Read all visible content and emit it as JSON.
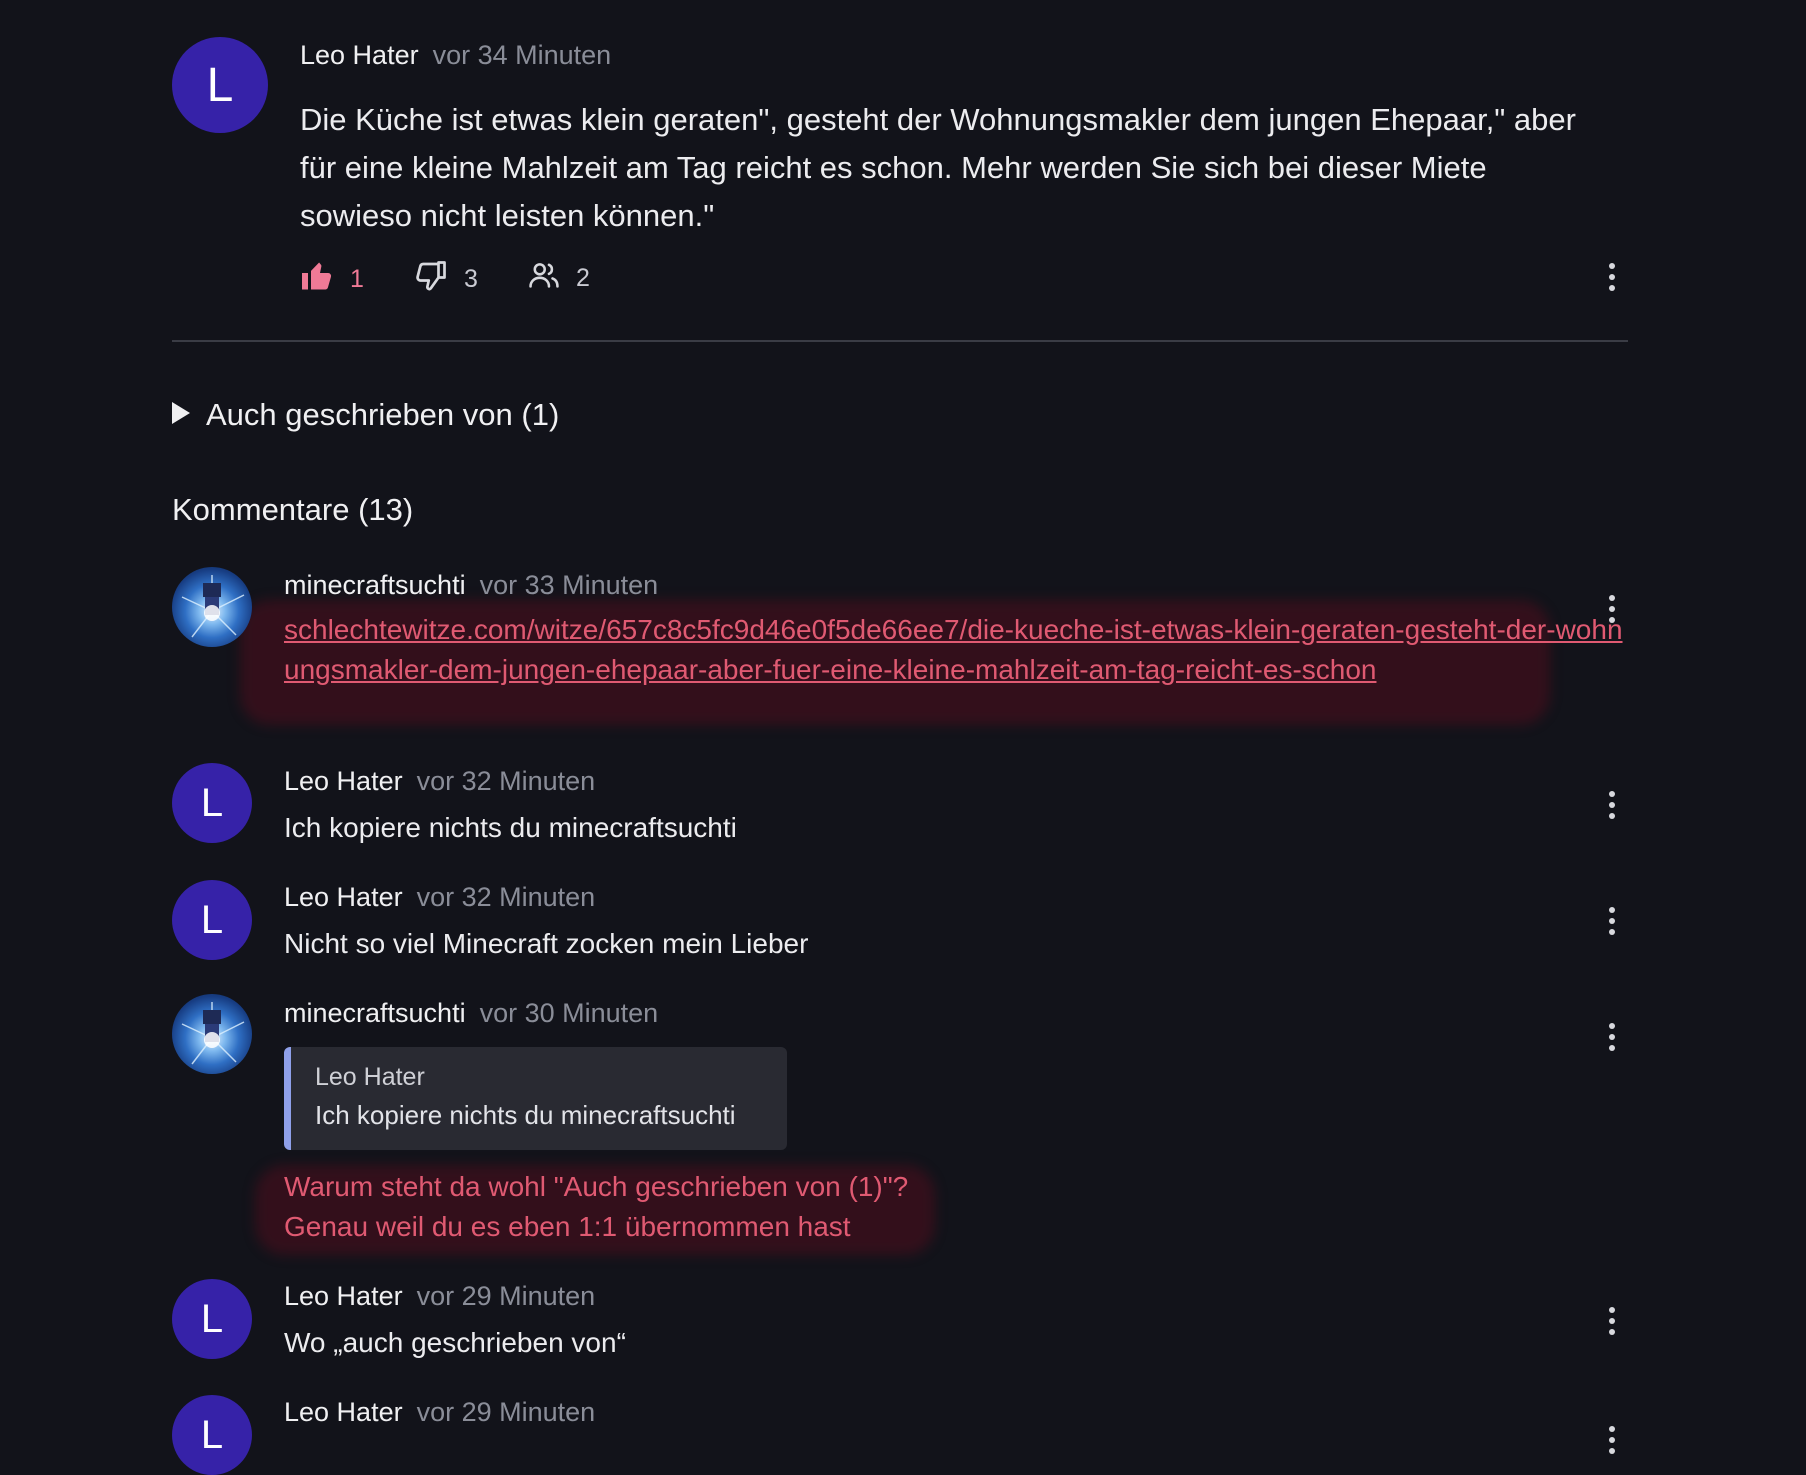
{
  "post": {
    "avatar_letter": "L",
    "author": "Leo Hater",
    "time": "vor 34 Minuten",
    "text": "Die Küche ist etwas klein geraten\", gesteht der Wohnungsmakler dem jungen Ehepaar,\" aber für eine kleine Mahlzeit am Tag reicht es schon. Mehr werden Sie sich bei dieser Miete sowieso nicht leisten können.\"",
    "likes": "1",
    "dislikes": "3",
    "shares": "2"
  },
  "also_written": "Auch geschrieben von (1)",
  "comments_heading": "Kommentare (13)",
  "comments": [
    {
      "author": "minecraftsuchti",
      "time": "vor 33 Minuten",
      "link": "schlechtewitze.com/witze/657c8c5fc9d46e0f5de66ee7/die-kueche-ist-etwas-klein-geraten-gesteht-der-wohnungsmakler-dem-jungen-ehepaar-aber-fuer-eine-kleine-mahlzeit-am-tag-reicht-es-schon"
    },
    {
      "avatar_letter": "L",
      "author": "Leo Hater",
      "time": "vor 32 Minuten",
      "text": "Ich kopiere nichts du minecraftsuchti"
    },
    {
      "avatar_letter": "L",
      "author": "Leo Hater",
      "time": "vor 32 Minuten",
      "text": "Nicht so viel Minecraft zocken mein Lieber"
    },
    {
      "author": "minecraftsuchti",
      "time": "vor 30 Minuten",
      "quote_author": "Leo Hater",
      "quote_text": "Ich kopiere nichts du minecraftsuchti",
      "text_line1": "Warum steht da wohl \"Auch geschrieben von (1)\"?",
      "text_line2": "Genau weil du es eben 1:1 übernommen hast"
    },
    {
      "avatar_letter": "L",
      "author": "Leo Hater",
      "time": "vor 29 Minuten",
      "text": "Wo „auch geschrieben von“"
    },
    {
      "avatar_letter": "L",
      "author": "Leo Hater",
      "time": "vor 29 Minuten"
    }
  ],
  "colors": {
    "background": "#12131a",
    "avatar": "#3622a8",
    "like_active": "#f07a96",
    "link": "#e05a72",
    "quote_bar": "#8fa0ea"
  },
  "icons": [
    "thumbs-up-icon",
    "thumbs-down-icon",
    "people-icon",
    "kebab-menu-icon",
    "triangle-right-icon"
  ]
}
